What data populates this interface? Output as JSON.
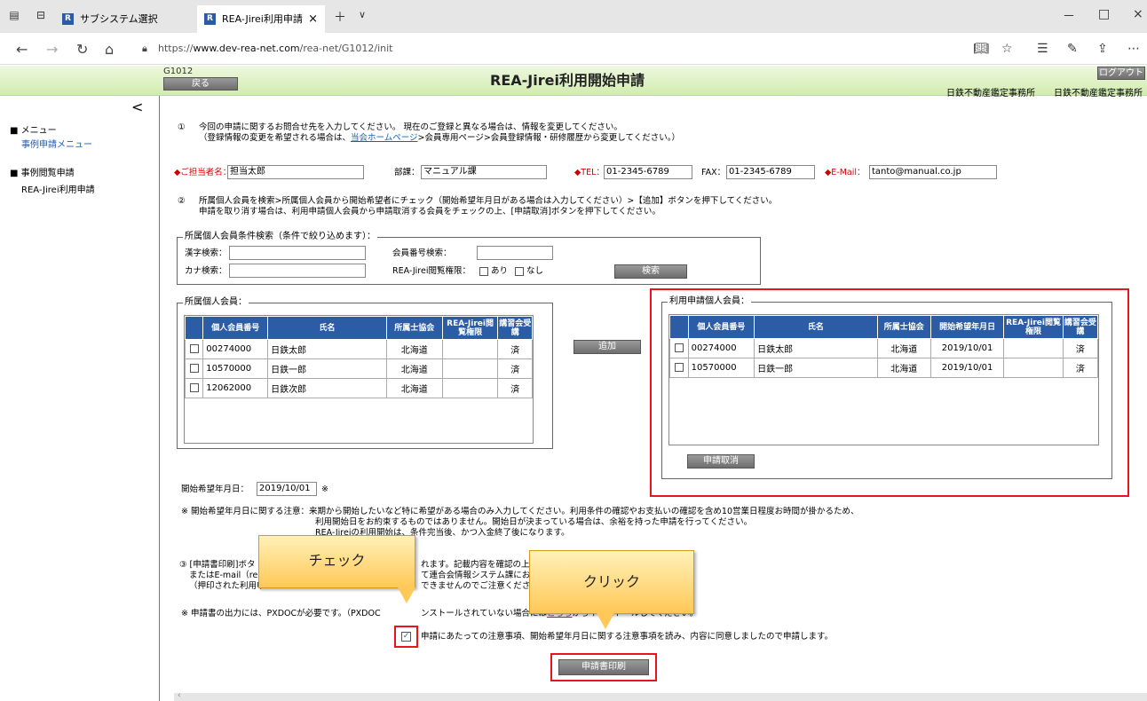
{
  "browser": {
    "tab1": "サブシステム選択",
    "tab2": "REA-Jirei利用申請",
    "tab_close": "×",
    "new_tab": "＋",
    "tab_list": "∨",
    "app_icon": "R",
    "url_scheme": "https://",
    "url_host": "www.dev-rea-net.com",
    "url_path": "/rea-net/G1012/init",
    "win_min": "－",
    "win_max": "□",
    "win_close": "×"
  },
  "header": {
    "page_id": "G1012",
    "back_label": "戻る",
    "title": "REA-Jirei利用開始申請",
    "logout_label": "ログアウト",
    "org1": "日鉄不動産鑑定事務所",
    "org2": "日鉄不動産鑑定事務所"
  },
  "sidebar": {
    "collapse": "<",
    "menu_heading": "■ メニュー",
    "menu_link": "事例申請メニュー",
    "section_heading": "■ 事例閲覧申請",
    "section_link": "REA-Jirei利用申請"
  },
  "step1": {
    "num": "①",
    "line1": "今回の申請に関するお問合せ先を入力してください。 現在のご登録と異なる場合は、情報を変更してください。",
    "line2_a": "（登録情報の変更を希望される場合は、",
    "line2_link": "当会ホームページ",
    "line2_b": ">会員専用ページ>会員登録情報・研修履歴から変更してください。）"
  },
  "contact": {
    "person_label": "◆ご担当者名：",
    "person_value": "担当太郎",
    "dept_label": "部課：",
    "dept_value": "マニュアル課",
    "tel_label": "◆TEL：",
    "tel_value": "01-2345-6789",
    "fax_label": "FAX：",
    "fax_value": "01-2345-6789",
    "mail_label": "◆E-Mail：",
    "mail_value": "tanto@manual.co.jp"
  },
  "step2": {
    "num": "②",
    "line1": "所属個人会員を検索>所属個人会員から開始希望者にチェック（開始希望年月日がある場合は入力してください）>【追加】ボタンを押下してください。",
    "line2": "申請を取り消す場合は、利用申請個人会員から申請取消する会員をチェックの上、[申請取消]ボタンを押下してください。"
  },
  "search": {
    "legend": "所属個人会員条件検索（条件で絞り込めます）：",
    "kanji_label": "漢字検索：",
    "kana_label": "カナ検索：",
    "member_no_label": "会員番号検索：",
    "rea_label": "REA-Jirei閲覧権限：",
    "ari": "あり",
    "nashi": "なし",
    "search_button": "検索"
  },
  "table_headers": {
    "member_no": "個人会員番号",
    "name": "氏名",
    "assoc": "所属士協会",
    "start_date": "開始希望年月日",
    "rea_perm": "REA-Jirei閲覧権限",
    "course": "講習会受講"
  },
  "members": {
    "legend": "所属個人会員：",
    "rows": [
      {
        "no": "00274000",
        "name": "日鉄太郎",
        "assoc": "北海道",
        "perm": "",
        "course": "済"
      },
      {
        "no": "10570000",
        "name": "日鉄一郎",
        "assoc": "北海道",
        "perm": "",
        "course": "済"
      },
      {
        "no": "12062000",
        "name": "日鉄次郎",
        "assoc": "北海道",
        "perm": "",
        "course": "済"
      }
    ]
  },
  "add_button": "追加",
  "applicants": {
    "legend": "利用申請個人会員：",
    "rows": [
      {
        "no": "00274000",
        "name": "日鉄太郎",
        "assoc": "北海道",
        "date": "2019/10/01",
        "perm": "",
        "course": "済"
      },
      {
        "no": "10570000",
        "name": "日鉄一郎",
        "assoc": "北海道",
        "date": "2019/10/01",
        "perm": "",
        "course": "済"
      }
    ],
    "cancel_button": "申請取消"
  },
  "start_date": {
    "label": "開始希望年月日：",
    "value": "2019/10/01",
    "mark": "※"
  },
  "notice": {
    "line1": "※ 開始希望年月日に関する注意：来期から開始したいなど特に希望がある場合のみ入力してください。利用条件の確認やお支払いの確認を含め10営業日程度お時間が掛かるため、",
    "line2": "利用開始日をお約束するものではありません。開始日が決まっている場合は、余裕を持った申請を行ってください。",
    "line3": "REA-Jireiの利用開始は、条件完当後、かつ入金終了後になります。"
  },
  "step3": {
    "l1a": "③ [申請書印刷]ボタ",
    "l1b": "れます。記載内容を確認の上",
    "l2a": "またはE-mail（re",
    "l2b": "て連合会情報システム課にお",
    "l3a": "（押印された利用申",
    "l3b": "できませんのでご注意ください。"
  },
  "pxdoc": {
    "a": "※ 申請書の出力には、PXDOCが必要です。（PXDOC",
    "b": "ンストールされていない場合には",
    "link": "こちら",
    "c": "からインストールしてください。"
  },
  "agree_label": "申請にあたっての注意事項、開始希望年月日に関する注意事項を読み、内容に同意しましたので申請します。",
  "print_button": "申請書印刷",
  "callouts": {
    "check": "チェック",
    "click": "クリック"
  },
  "colors": {
    "header_blue": "#2c5ca6",
    "highlight_red": "#e8141e",
    "required_red": "#d40000",
    "callout_fill": "#ffd36b"
  }
}
